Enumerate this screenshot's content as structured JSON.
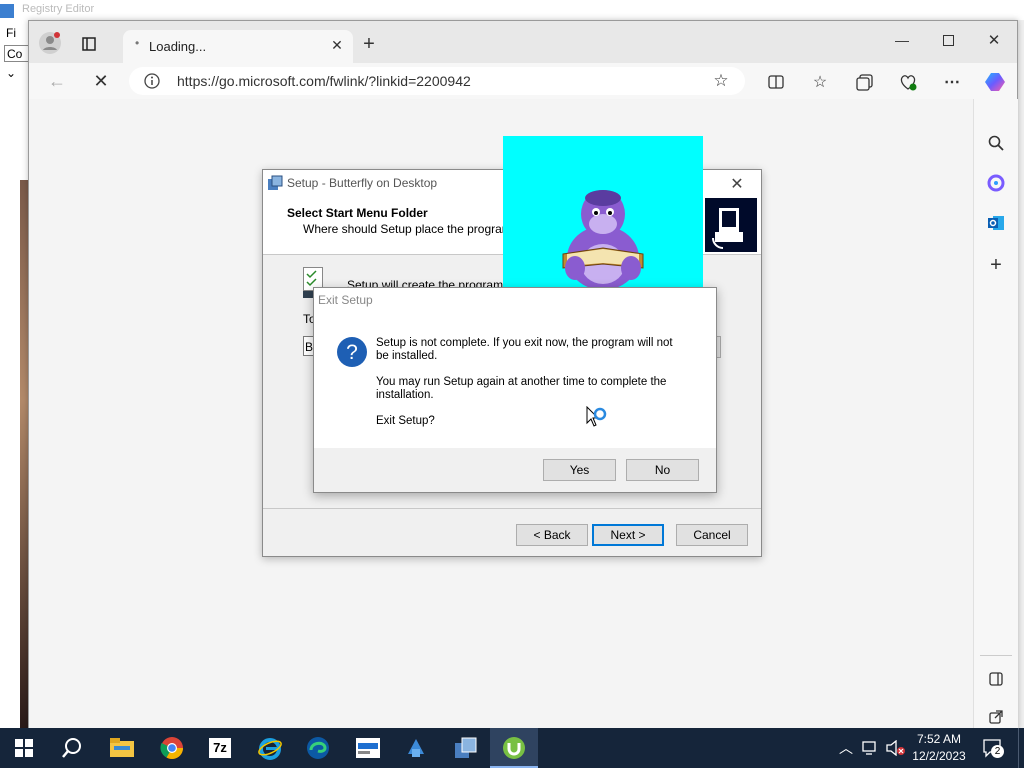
{
  "background_app": {
    "title": "Registry Editor",
    "menu_first": "Fi",
    "field_text": "Co"
  },
  "browser": {
    "tab": {
      "title": "Loading...",
      "dot": "•"
    },
    "address": {
      "url": "https://go.microsoft.com/fwlink/?linkid=2200942"
    }
  },
  "setup": {
    "title": "Setup - Butterfly on Desktop",
    "header_title": "Select Start Menu Folder",
    "header_subtitle": "Where should Setup place the program's s",
    "body_text": "Setup will create the program's s",
    "to_label": "To",
    "folder_value": "Bu",
    "buttons": {
      "back": "< Back",
      "next": "Next >",
      "cancel": "Cancel"
    }
  },
  "exit_dialog": {
    "title": "Exit Setup",
    "message_line1": "Setup is not complete. If you exit now, the program will not",
    "message_line2": "be installed.",
    "message_line3": "You may run Setup again at another time to complete the",
    "message_line4": "installation.",
    "question": "Exit Setup?",
    "buttons": {
      "yes": "Yes",
      "no": "No"
    }
  },
  "taskbar": {
    "time": "7:52 AM",
    "date": "12/2/2023",
    "notification_count": "2",
    "apps": [
      "start-icon",
      "search-icon",
      "file-explorer-icon",
      "chrome-icon",
      "7zip-icon",
      "ie-icon",
      "edge-icon",
      "app-icon",
      "registry-icon",
      "setup-icon",
      "utorrent-icon"
    ]
  },
  "colors": {
    "accent": "#0078d7",
    "popup_bg": "#00ffff",
    "taskbar": "#15253a"
  }
}
